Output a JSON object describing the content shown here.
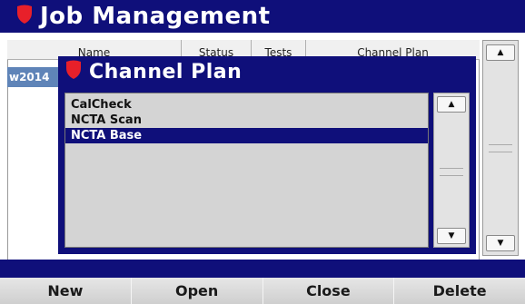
{
  "app": {
    "title": "Job Management",
    "accent": "#0f0f7a",
    "logo_icon": "shield-icon",
    "logo_color": "#e8202a"
  },
  "table": {
    "columns": [
      "Name",
      "Status",
      "Tests",
      "Channel Plan"
    ],
    "rows": [
      {
        "name": "w2014",
        "selected": true
      }
    ]
  },
  "dialog": {
    "title": "Channel Plan",
    "items": [
      {
        "label": "CalCheck",
        "selected": false
      },
      {
        "label": "NCTA Scan",
        "selected": false
      },
      {
        "label": "NCTA Base",
        "selected": true
      }
    ]
  },
  "scrollbar": {
    "up_icon": "arrow-up-icon",
    "down_icon": "arrow-down-icon"
  },
  "softkeys": [
    {
      "label": "New"
    },
    {
      "label": "Open"
    },
    {
      "label": "Close"
    },
    {
      "label": "Delete"
    }
  ]
}
